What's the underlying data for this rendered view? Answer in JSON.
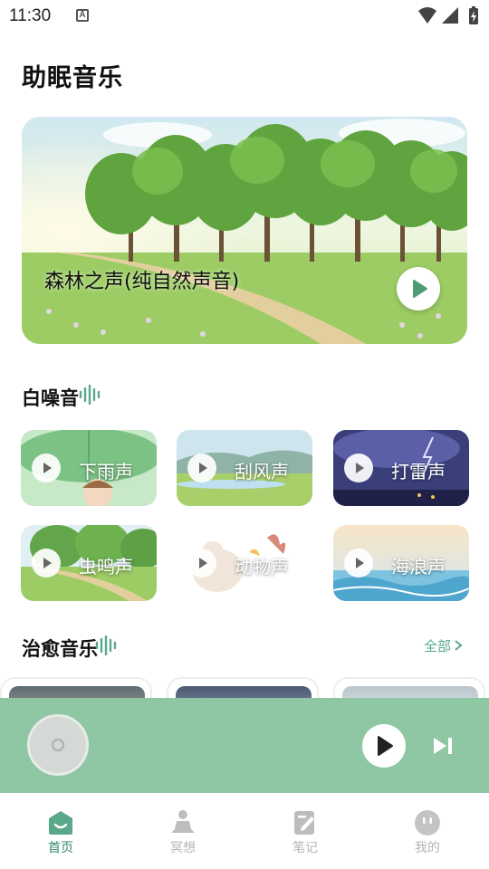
{
  "status_bar": {
    "time": "11:30",
    "notification_glyph": "A"
  },
  "page": {
    "title": "助眠音乐"
  },
  "banner": {
    "title": "森林之声(纯自然声音)"
  },
  "white_noise": {
    "title": "白噪音",
    "items": [
      {
        "label": "下雨声"
      },
      {
        "label": "刮风声"
      },
      {
        "label": "打雷声"
      },
      {
        "label": "虫鸣声"
      },
      {
        "label": "动物声"
      },
      {
        "label": "海浪声"
      }
    ]
  },
  "healing_music": {
    "title": "治愈音乐",
    "see_all": "全部"
  },
  "bottom_nav": {
    "items": [
      {
        "label": "首页",
        "active": true
      },
      {
        "label": "冥想",
        "active": false
      },
      {
        "label": "笔记",
        "active": false
      },
      {
        "label": "我的",
        "active": false
      }
    ]
  },
  "colors": {
    "accent": "#5aa88a",
    "player_bg": "#8fc7a4",
    "nav_active": "#2e8a66",
    "nav_inactive": "#b5b5b5"
  }
}
